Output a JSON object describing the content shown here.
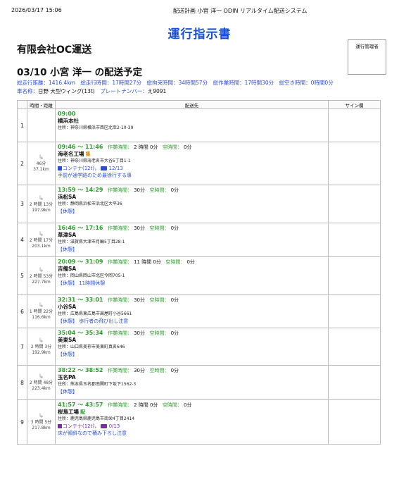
{
  "header": {
    "datetime": "2026/03/17 15:06",
    "system": "配送計画 小宮 洋一 ODIN リアルタイム配送システム"
  },
  "title": "運行指示書",
  "company": "有限会社OC運送",
  "manager_label": "運行管理者",
  "plan_title": "03/10 小宮 洋一 の配送予定",
  "stats": "総走行距離：1416.4km　総走行時間：17時間27分　総拘束時間：34時間57分　総作業時間：17時間30分　総空き時間：0時間0分",
  "vehicle": {
    "label": "車名称：",
    "name": "日野 大型ウィング(13t)",
    "plate_label": "プレートナンバー：",
    "plate": "え9091"
  },
  "table": {
    "col_time": "時間・距離",
    "col_dest": "配送先",
    "col_sign": "サイン欄"
  },
  "labels": {
    "work": "作業時間：",
    "free": "空時間："
  },
  "rows": [
    {
      "no": "1",
      "duration": "",
      "distance": "",
      "time": "09:00",
      "work": "",
      "free": "",
      "name": "横浜本社",
      "tag": "",
      "address": "住所：神奈川県横浜市西区北幸2-10-39",
      "cargo": "",
      "note": ""
    },
    {
      "no": "2",
      "duration": "46分",
      "distance": "37.1km",
      "time": "09:46 ～ 11:46",
      "work": "2 時間 0分",
      "free": "0分",
      "name": "海老名工場",
      "tag": "集",
      "address": "住所：神奈川県海老名市大谷5丁目1-1",
      "cargo": "コンテナ(12t)，",
      "cargo_count": "12/13",
      "note": "手前が通学路のため最徐行する事"
    },
    {
      "no": "3",
      "duration": "2 時間 13分",
      "distance": "197.9km",
      "time": "13:59 ～ 14:29",
      "work": "30分",
      "free": "0分",
      "name": "浜松SA",
      "tag": "",
      "address": "住所：静岡県浜松市浜北区大平36",
      "cargo": "",
      "note": "【休憩】"
    },
    {
      "no": "4",
      "duration": "2 時間 17分",
      "distance": "203.1km",
      "time": "16:46 ～ 17:16",
      "work": "30分",
      "free": "0分",
      "name": "草津SA",
      "tag": "",
      "address": "住所：滋賀県大津市月輪5丁目28-1",
      "cargo": "",
      "note": "【休憩】"
    },
    {
      "no": "5",
      "duration": "2 時間 53分",
      "distance": "227.7km",
      "time": "20:09 ～ 31:09",
      "work": "11 時間 0分",
      "free": "0分",
      "name": "吉備SA",
      "tag": "",
      "address": "住所：岡山県岡山市北区今岡705-1",
      "cargo": "",
      "note": "【休憩】 11時間休憩"
    },
    {
      "no": "6",
      "duration": "1 時間 22分",
      "distance": "116.6km",
      "time": "32:31 ～ 33:01",
      "work": "30分",
      "free": "0分",
      "name": "小谷SA",
      "tag": "",
      "address": "住所：広島県東広島市高屋町小谷5661",
      "cargo": "",
      "note": "【休憩】 歩行者の飛び出し注意"
    },
    {
      "no": "7",
      "duration": "2 時間 3分",
      "distance": "192.9km",
      "time": "35:04 ～ 35:34",
      "work": "30分",
      "free": "0分",
      "name": "美東SA",
      "tag": "",
      "address": "住所：山口県美祢市美東町真名646",
      "cargo": "",
      "note": "【休憩】"
    },
    {
      "no": "8",
      "duration": "2 時間 48分",
      "distance": "223.4km",
      "time": "38:22 ～ 38:52",
      "work": "30分",
      "free": "0分",
      "name": "玉名PA",
      "tag": "",
      "address": "住所：熊本県玉名郡南関町下坂下1562-3",
      "cargo": "",
      "note": "【休憩】"
    },
    {
      "no": "9",
      "duration": "3 時間 5分",
      "distance": "217.8km",
      "time": "41:57 ～ 43:57",
      "work": "2 時間 0分",
      "free": "0分",
      "name": "桜島工場",
      "tag": "配",
      "address": "住所：鹿児島県鹿児島市南栄4丁目2414",
      "cargo": "コンテナ(12t)，",
      "cargo_count": "0/13",
      "note": "床が傾斜なので積み下ろし注意"
    }
  ],
  "colors": {
    "title": "#1a4fd6",
    "time": "#2ca02c",
    "note": "#2b4fcf",
    "pickup_tag": "#d98b00",
    "delivery_tag": "#2ca02c",
    "delivery_cargo": "#7a2b9e"
  },
  "icons": [
    "arrow-icon",
    "container-icon",
    "truck-icon"
  ]
}
